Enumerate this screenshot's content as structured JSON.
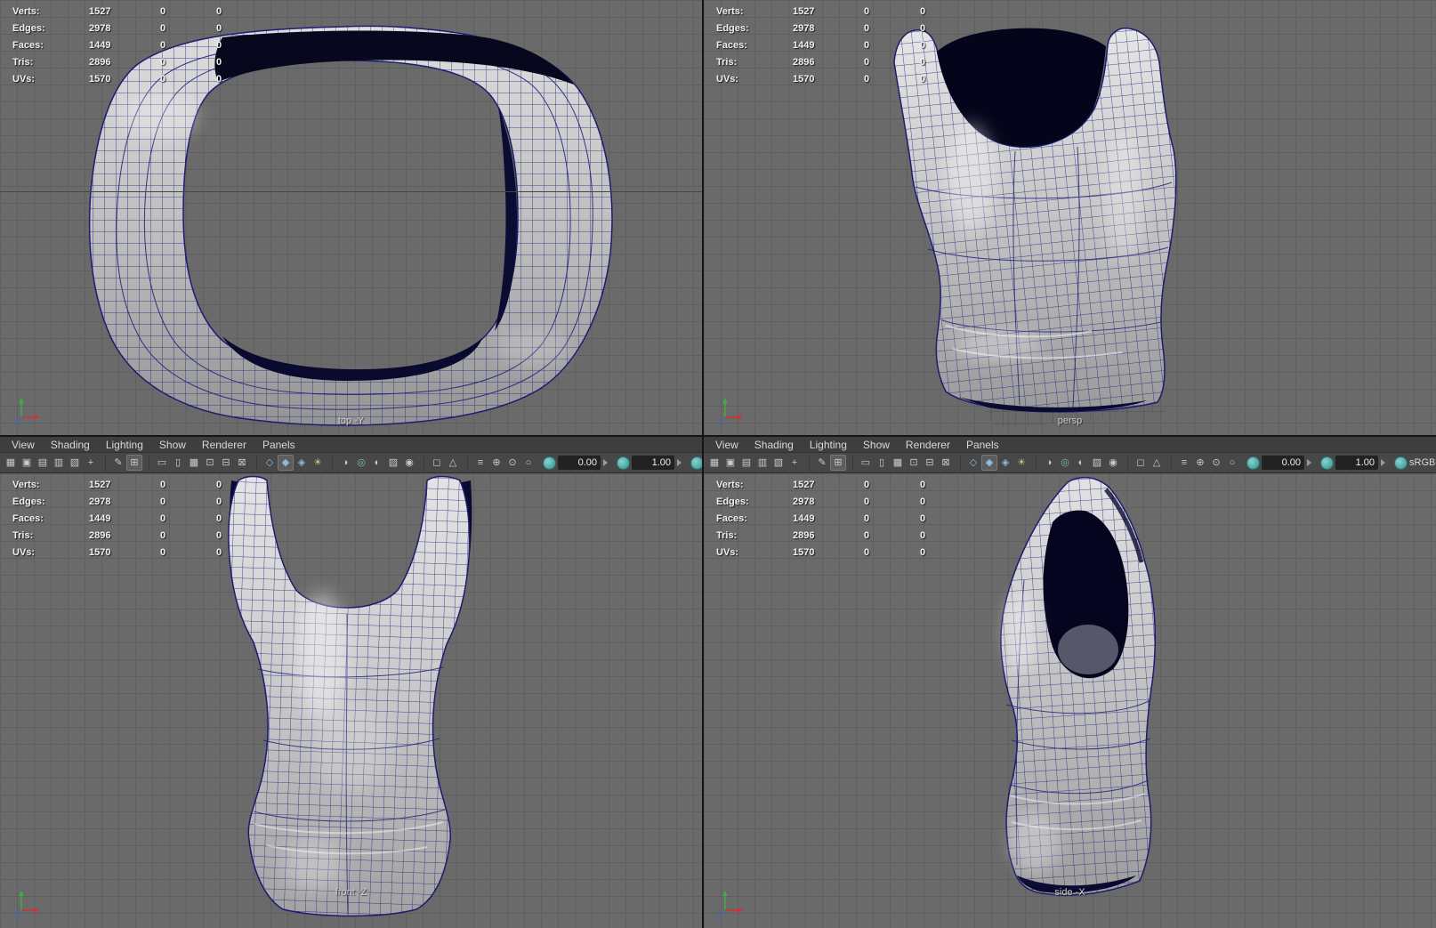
{
  "viewports": {
    "top_left": {
      "label": "top -Y"
    },
    "top_right": {
      "label": "persp"
    },
    "bottom_left": {
      "label": "front -Z"
    },
    "bottom_right": {
      "label": "side -X"
    }
  },
  "hud": {
    "rows": [
      {
        "label": "Verts:",
        "v1": "1527",
        "v2": "0",
        "v3": "0"
      },
      {
        "label": "Edges:",
        "v1": "2978",
        "v2": "0",
        "v3": "0"
      },
      {
        "label": "Faces:",
        "v1": "1449",
        "v2": "0",
        "v3": "0"
      },
      {
        "label": "Tris:",
        "v1": "2896",
        "v2": "0",
        "v3": "0"
      },
      {
        "label": "UVs:",
        "v1": "1570",
        "v2": "0",
        "v3": "0"
      }
    ]
  },
  "menu": {
    "items": [
      {
        "label": "View"
      },
      {
        "label": "Shading"
      },
      {
        "label": "Lighting"
      },
      {
        "label": "Show"
      },
      {
        "label": "Renderer"
      },
      {
        "label": "Panels"
      }
    ]
  },
  "toolbar": {
    "icons": [
      {
        "name": "select-camera-icon",
        "glyph": "▦"
      },
      {
        "name": "lock-camera-icon",
        "glyph": "▣"
      },
      {
        "name": "camera-attributes-icon",
        "glyph": "▤"
      },
      {
        "name": "bookmarks-icon",
        "glyph": "▥"
      },
      {
        "name": "image-plane-icon",
        "glyph": "▧"
      },
      {
        "name": "two-d-pan-zoom-icon",
        "glyph": "+"
      },
      {
        "name": "grease-pencil-icon",
        "glyph": "✎"
      },
      {
        "name": "grid-icon",
        "glyph": "⊞",
        "active": true
      },
      {
        "name": "film-gate-icon",
        "glyph": "▭"
      },
      {
        "name": "resolution-gate-icon",
        "glyph": "▯"
      },
      {
        "name": "gate-mask-icon",
        "glyph": "▩"
      },
      {
        "name": "field-chart-icon",
        "glyph": "⊡"
      },
      {
        "name": "safe-action-icon",
        "glyph": "⊟"
      },
      {
        "name": "safe-title-icon",
        "glyph": "⊠"
      },
      {
        "name": "wireframe-icon",
        "glyph": "◇",
        "color": "#8fb8dc"
      },
      {
        "name": "shaded-icon",
        "glyph": "◆",
        "color": "#8fb8dc",
        "active": true
      },
      {
        "name": "textured-icon",
        "glyph": "◈",
        "color": "#8fb8dc"
      },
      {
        "name": "use-all-lights-icon",
        "glyph": "☀",
        "color": "#d8c878"
      },
      {
        "name": "shadows-icon",
        "glyph": "◑"
      },
      {
        "name": "ambient-occlusion-icon",
        "glyph": "◎",
        "color": "#7fb8b4"
      },
      {
        "name": "motion-blur-icon",
        "glyph": "◐"
      },
      {
        "name": "multisample-aa-icon",
        "glyph": "▨"
      },
      {
        "name": "depth-of-field-icon",
        "glyph": "◉"
      },
      {
        "name": "isolate-select-icon",
        "glyph": "◻"
      },
      {
        "name": "x-ray-icon",
        "glyph": "△"
      },
      {
        "name": "object-details-icon",
        "glyph": "≡"
      },
      {
        "name": "frame-all-icon",
        "glyph": "⊕"
      },
      {
        "name": "frame-selection-icon",
        "glyph": "⊙"
      },
      {
        "name": "highlight-selection-icon",
        "glyph": "○"
      }
    ],
    "exposure_value": "0.00",
    "gamma_value": "1.00",
    "view_transform_label": "sRGB g"
  },
  "colors": {
    "viewport_bg": "#6a6a6a",
    "grid_line": "#5f5f5f",
    "wireframe": "#23237d",
    "surface_light": "#e2e2e2",
    "surface_dark": "#8f8f8f",
    "interior_dark": "#06061d",
    "menu_bg": "#3e3e3e",
    "toolbar_bg": "#474747",
    "accent_teal": "#3fa8a8"
  }
}
